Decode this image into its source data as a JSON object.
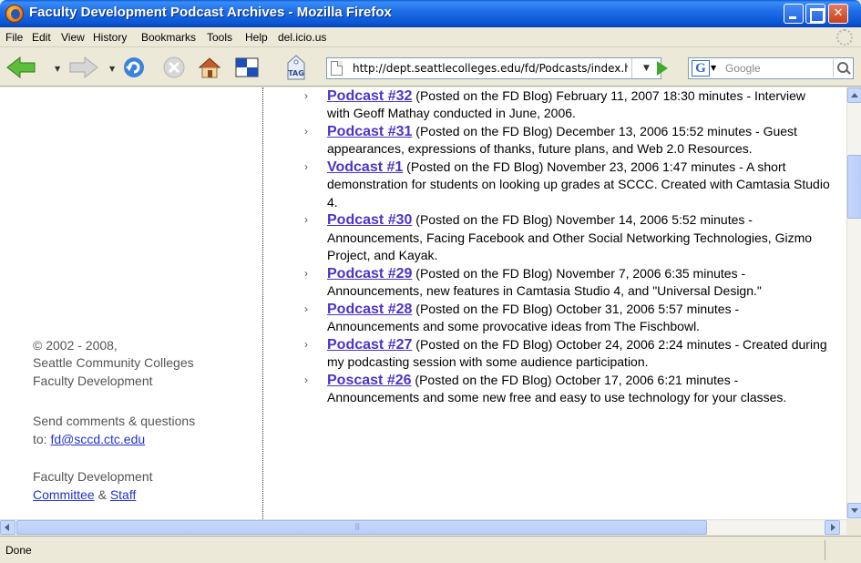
{
  "window": {
    "title": "Faculty Development Podcast Archives - Mozilla Firefox",
    "controls": {
      "minimize": "",
      "maximize": "",
      "close": "✕"
    }
  },
  "menu": {
    "items": [
      "File",
      "Edit",
      "View",
      "History",
      "Bookmarks",
      "Tools",
      "Help",
      "del.icio.us"
    ]
  },
  "toolbar": {
    "url": "http://dept.seattlecolleges.edu/fd/Podcasts/index.html",
    "search_placeholder": "Google",
    "tag_label": "TAG",
    "search_engine_icon": "G"
  },
  "sidebar": {
    "copyright_line1": "© 2002 - 2008,",
    "copyright_line2": "Seattle Community Colleges",
    "copyright_line3": "Faculty Development",
    "comments_line1": "Send comments & questions",
    "comments_prefix": "to: ",
    "comments_email": "fd@sccd.ctc.edu",
    "fd_line1": "Faculty Development",
    "committee_link": "Committee",
    "amp": " & ",
    "staff_link": "Staff"
  },
  "podcasts": [
    {
      "title": "Podcast #32",
      "text": " (Posted on the FD Blog) February 11, 2007 18:30 minutes - Interview with Geoff Mathay conducted in June, 2006."
    },
    {
      "title": "Podcast #31",
      "text": " (Posted on the FD Blog) December 13, 2006 15:52 minutes - Guest appearances, expressions of thanks, future plans, and Web 2.0 Resources."
    },
    {
      "title": "Vodcast #1",
      "text": " (Posted on the FD Blog) November 23, 2006 1:47 minutes - A short demonstration for students on looking up grades at SCCC. Created with Camtasia Studio 4."
    },
    {
      "title": "Podcast #30",
      "text": " (Posted on the FD Blog) November 14, 2006 5:52 minutes - Announcements, Facing Facebook and Other Social Networking Technologies, Gizmo Project, and Kayak."
    },
    {
      "title": "Podcast #29",
      "text": " (Posted on the FD Blog) November 7, 2006 6:35 minutes - Announcements, new features in Camtasia Studio 4, and \"Universal Design.\""
    },
    {
      "title": "Podcast #28",
      "text": " (Posted on the FD Blog) October 31, 2006 5:57 minutes - Announcements and some provocative ideas from The Fischbowl."
    },
    {
      "title": "Podcast #27",
      "text": " (Posted on the FD Blog) October 24, 2006 2:24 minutes - Created during my podcasting session with some audience participation."
    },
    {
      "title": "Poscast #26",
      "text": " (Posted on the FD Blog) October 17, 2006 6:21 minutes - Announcements and some new free and easy to use technology for your classes."
    }
  ],
  "status": {
    "text": "Done"
  },
  "colors": {
    "link": "#4b35c9",
    "sidebar_link": "#2233cc",
    "titlebar": "#1f6ee9"
  }
}
